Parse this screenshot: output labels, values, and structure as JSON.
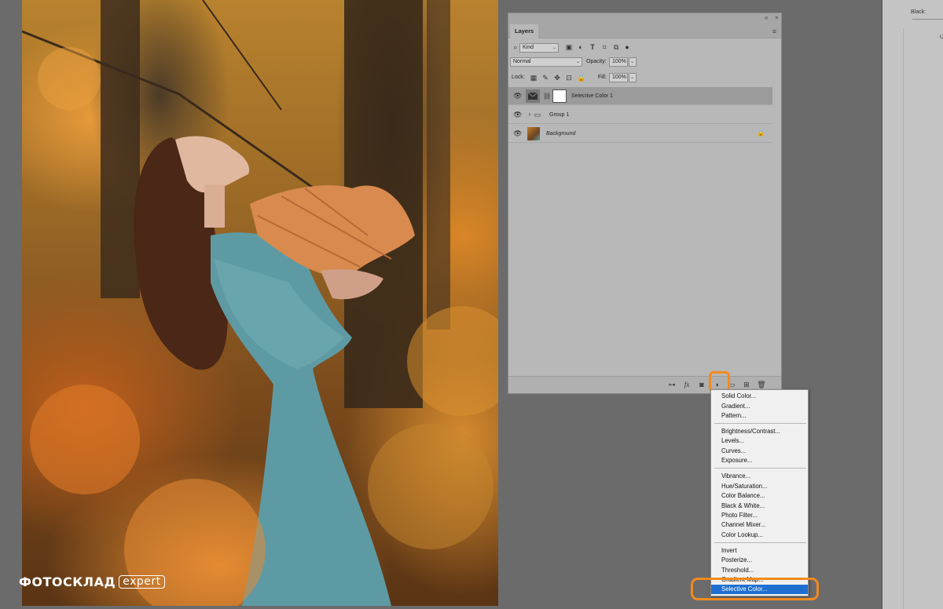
{
  "watermark": {
    "brand": "ФОТОСКЛАД",
    "suffix": "expert"
  },
  "right_panel": {
    "label": "Black:"
  },
  "layers_panel": {
    "tab": "Layers",
    "filter": {
      "kind_label": "Kind"
    },
    "blend": {
      "mode": "Normal",
      "opacity_label": "Opacity:",
      "opacity_value": "100%"
    },
    "lock": {
      "label": "Lock:",
      "fill_label": "Fill:",
      "fill_value": "100%"
    },
    "layers": [
      {
        "name": "Selective Color 1",
        "type": "adjustment",
        "visible": true,
        "selected": true
      },
      {
        "name": "Group 1",
        "type": "group",
        "visible": true,
        "selected": false
      },
      {
        "name": "Background",
        "type": "image",
        "visible": true,
        "selected": false,
        "locked": true
      }
    ],
    "bottom_icons": [
      "link-icon",
      "fx-icon",
      "mask-icon",
      "adjustment-layer-icon",
      "folder-icon",
      "new-layer-icon",
      "trash-icon"
    ],
    "fx_label": "fx"
  },
  "adjustment_menu": {
    "groups": [
      [
        "Solid Color...",
        "Gradient...",
        "Pattern..."
      ],
      [
        "Brightness/Contrast...",
        "Levels...",
        "Curves...",
        "Exposure..."
      ],
      [
        "Vibrance...",
        "Hue/Saturation...",
        "Color Balance...",
        "Black & White...",
        "Photo Filter...",
        "Channel Mixer...",
        "Color Lookup..."
      ],
      [
        "Invert",
        "Posterize...",
        "Threshold...",
        "Gradient Map...",
        "Selective Color..."
      ]
    ],
    "highlighted": "Selective Color..."
  },
  "colors": {
    "highlight_ring": "#f28a1e",
    "menu_selection": "#1f6fd1"
  }
}
